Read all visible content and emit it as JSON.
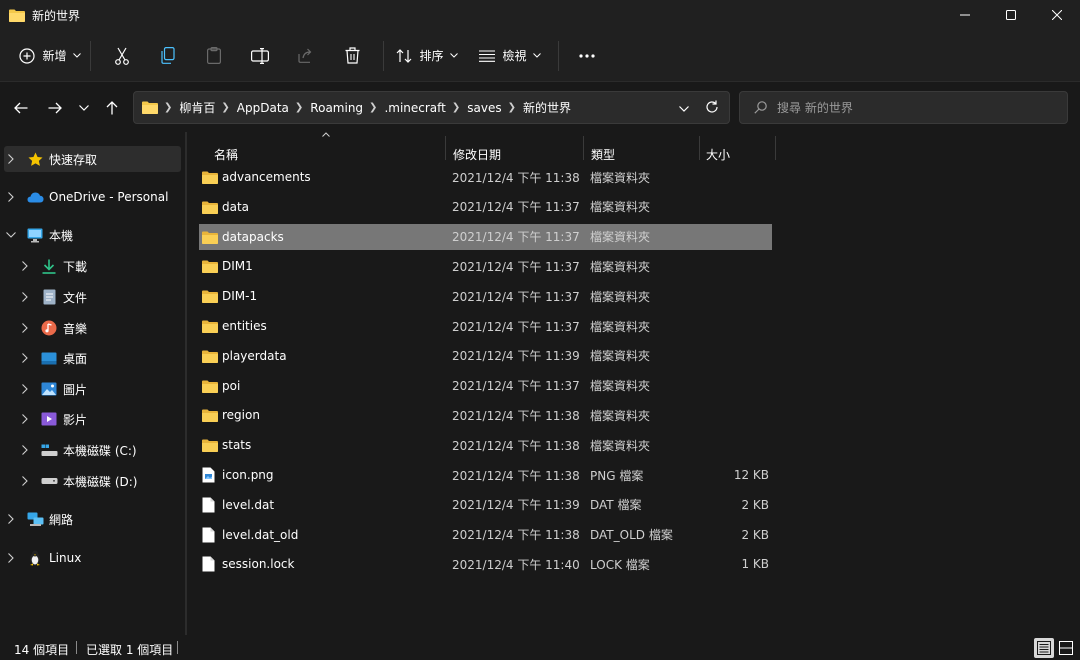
{
  "window": {
    "title": "新的世界"
  },
  "toolbar": {
    "new_label": "新增",
    "sort_label": "排序",
    "view_label": "檢視"
  },
  "address": {
    "crumbs": [
      "柳肯百",
      "AppData",
      "Roaming",
      ".minecraft",
      "saves",
      "新的世界"
    ]
  },
  "search": {
    "placeholder": "搜尋 新的世界"
  },
  "sidebar": {
    "items": [
      {
        "label": "快速存取",
        "icon": "star-icon"
      },
      {
        "label": "OneDrive - Personal",
        "icon": "cloud-icon"
      },
      {
        "label": "本機",
        "icon": "monitor-icon"
      },
      {
        "label": "下載",
        "icon": "download-icon"
      },
      {
        "label": "文件",
        "icon": "document-icon"
      },
      {
        "label": "音樂",
        "icon": "music-icon"
      },
      {
        "label": "桌面",
        "icon": "desktop-icon"
      },
      {
        "label": "圖片",
        "icon": "pictures-icon"
      },
      {
        "label": "影片",
        "icon": "videos-icon"
      },
      {
        "label": "本機磁碟 (C:)",
        "icon": "drive-c-icon"
      },
      {
        "label": "本機磁碟 (D:)",
        "icon": "drive-d-icon"
      },
      {
        "label": "網路",
        "icon": "network-icon"
      },
      {
        "label": "Linux",
        "icon": "linux-icon"
      }
    ]
  },
  "columns": {
    "name": "名稱",
    "date": "修改日期",
    "type": "類型",
    "size": "大小"
  },
  "files": [
    {
      "name": "advancements",
      "date": "2021/12/4 下午 11:38",
      "type": "檔案資料夾",
      "size": "",
      "kind": "folder"
    },
    {
      "name": "data",
      "date": "2021/12/4 下午 11:37",
      "type": "檔案資料夾",
      "size": "",
      "kind": "folder"
    },
    {
      "name": "datapacks",
      "date": "2021/12/4 下午 11:37",
      "type": "檔案資料夾",
      "size": "",
      "kind": "folder"
    },
    {
      "name": "DIM1",
      "date": "2021/12/4 下午 11:37",
      "type": "檔案資料夾",
      "size": "",
      "kind": "folder"
    },
    {
      "name": "DIM-1",
      "date": "2021/12/4 下午 11:37",
      "type": "檔案資料夾",
      "size": "",
      "kind": "folder"
    },
    {
      "name": "entities",
      "date": "2021/12/4 下午 11:37",
      "type": "檔案資料夾",
      "size": "",
      "kind": "folder"
    },
    {
      "name": "playerdata",
      "date": "2021/12/4 下午 11:39",
      "type": "檔案資料夾",
      "size": "",
      "kind": "folder"
    },
    {
      "name": "poi",
      "date": "2021/12/4 下午 11:37",
      "type": "檔案資料夾",
      "size": "",
      "kind": "folder"
    },
    {
      "name": "region",
      "date": "2021/12/4 下午 11:38",
      "type": "檔案資料夾",
      "size": "",
      "kind": "folder"
    },
    {
      "name": "stats",
      "date": "2021/12/4 下午 11:38",
      "type": "檔案資料夾",
      "size": "",
      "kind": "folder"
    },
    {
      "name": "icon.png",
      "date": "2021/12/4 下午 11:38",
      "type": "PNG 檔案",
      "size": "12 KB",
      "kind": "image"
    },
    {
      "name": "level.dat",
      "date": "2021/12/4 下午 11:39",
      "type": "DAT 檔案",
      "size": "2 KB",
      "kind": "file"
    },
    {
      "name": "level.dat_old",
      "date": "2021/12/4 下午 11:38",
      "type": "DAT_OLD 檔案",
      "size": "2 KB",
      "kind": "file"
    },
    {
      "name": "session.lock",
      "date": "2021/12/4 下午 11:40",
      "type": "LOCK 檔案",
      "size": "1 KB",
      "kind": "file"
    }
  ],
  "status": {
    "count": "14 個項目",
    "selected": "已選取 1 個項目"
  },
  "colors": {
    "folder": "#f4c84a",
    "selection": "#777777",
    "accent": "#4cc2ff"
  }
}
